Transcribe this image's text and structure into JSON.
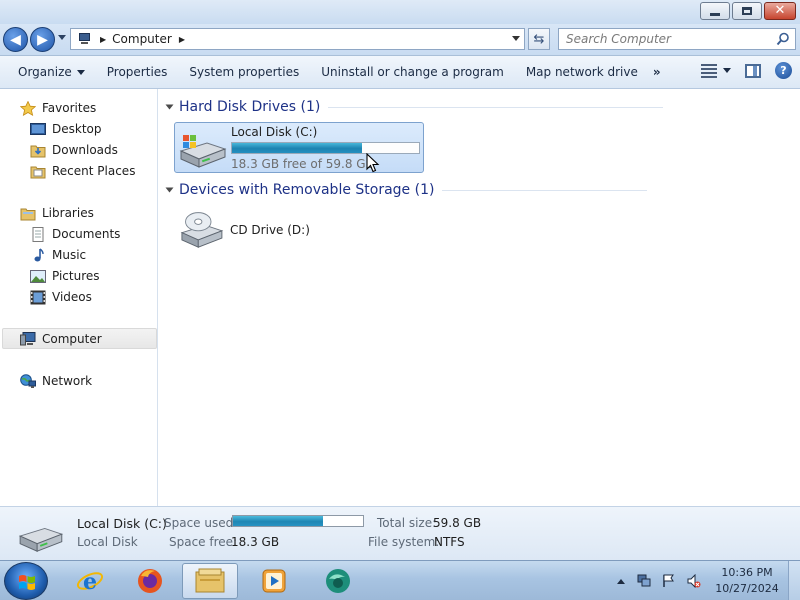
{
  "window": {
    "minimize_icon": "minimize-icon",
    "maximize_icon": "restore-icon",
    "close_icon": "close-icon"
  },
  "address": {
    "location": "Computer",
    "search_placeholder": "Search Computer"
  },
  "toolbar": {
    "organize": "Organize",
    "properties": "Properties",
    "system_properties": "System properties",
    "uninstall": "Uninstall or change a program",
    "map_network": "Map network drive",
    "more": "»"
  },
  "sidebar": {
    "favorites": "Favorites",
    "desktop": "Desktop",
    "downloads": "Downloads",
    "recent_places": "Recent Places",
    "libraries": "Libraries",
    "documents": "Documents",
    "music": "Music",
    "pictures": "Pictures",
    "videos": "Videos",
    "computer": "Computer",
    "network": "Network"
  },
  "content": {
    "hdd_group": "Hard Disk Drives (1)",
    "removable_group": "Devices with Removable Storage (1)",
    "local_disk": {
      "name": "Local Disk (C:)",
      "free_text": "18.3 GB free of 59.8 GB",
      "used_fraction": 0.694
    },
    "cd_drive": {
      "name": "CD Drive (D:)"
    }
  },
  "details": {
    "name": "Local Disk (C:)",
    "type": "Local Disk",
    "space_used_label": "Space used:",
    "space_free_label": "Space free:",
    "space_free_value": "18.3 GB",
    "total_size_label": "Total size:",
    "total_size_value": "59.8 GB",
    "file_system_label": "File system:",
    "file_system_value": "NTFS",
    "used_fraction": 0.694
  },
  "taskbar": {
    "apps": [
      "internet-explorer",
      "firefox",
      "windows-explorer",
      "media-player",
      "app-globe"
    ],
    "time": "10:36 PM",
    "date": "10/27/2024"
  },
  "colors": {
    "group_title": "#1e3287",
    "bar_fill": "#1d83b1",
    "selection": "#c5dcf7"
  }
}
